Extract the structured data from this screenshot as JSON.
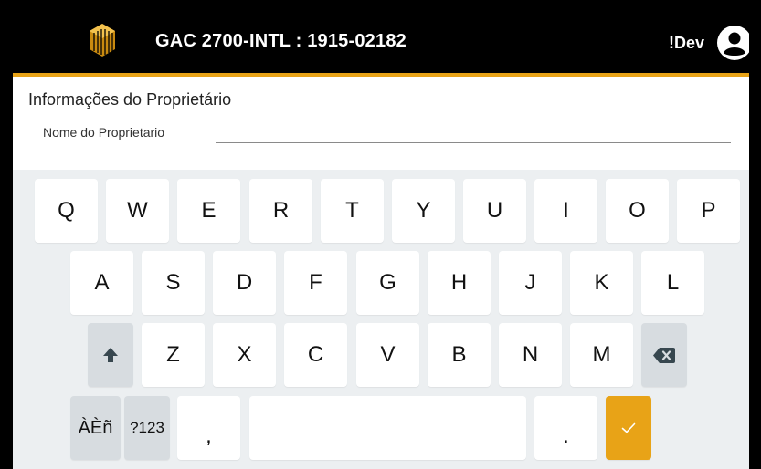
{
  "header": {
    "device_title": "GAC 2700-INTL : 1915-02182",
    "user_label": "!Dev",
    "logo_icon": "gac-logo-icon",
    "avatar_icon": "account-circle-icon",
    "accent_color": "#e8a317"
  },
  "form": {
    "section_title": "Informações do Proprietário",
    "owner_name_label": "Nome do Proprietario",
    "owner_name_value": ""
  },
  "keyboard": {
    "row1": [
      "Q",
      "W",
      "E",
      "R",
      "T",
      "Y",
      "U",
      "I",
      "O",
      "P"
    ],
    "row2": [
      "A",
      "S",
      "D",
      "F",
      "G",
      "H",
      "J",
      "K",
      "L"
    ],
    "row3": [
      "Z",
      "X",
      "C",
      "V",
      "B",
      "N",
      "M"
    ],
    "shift_icon": "shift-arrow-icon",
    "backspace_icon": "backspace-icon",
    "accents_label": "ÀÈñ",
    "numeric_label": "?123",
    "comma_label": ",",
    "period_label": ".",
    "enter_icon": "checkmark-icon"
  }
}
